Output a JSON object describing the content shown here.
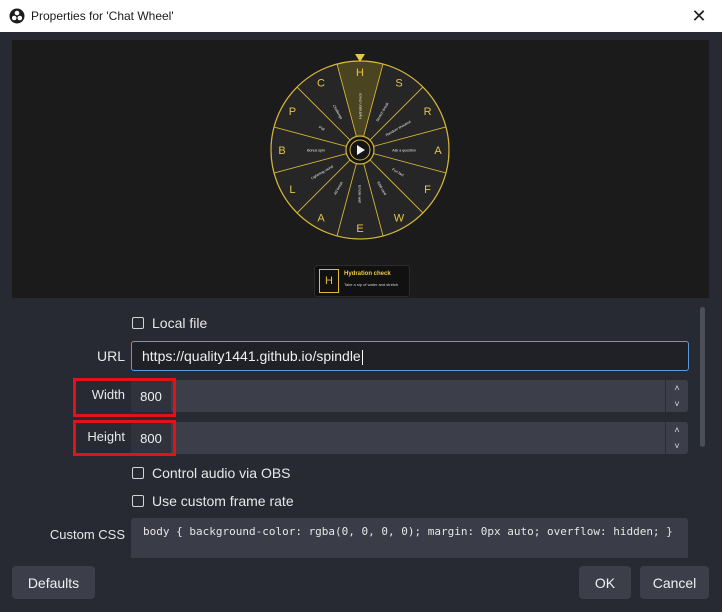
{
  "window": {
    "title": "Properties for 'Chat Wheel'",
    "close_glyph": "✕"
  },
  "preview": {
    "wheel": {
      "colors": {
        "segment_fill": "#262626",
        "segment_alt_fill": "#4a4420",
        "border": "#d4b63a",
        "letter": "#e6c448"
      },
      "segments": [
        {
          "key": "H",
          "label": "Hydration check"
        },
        {
          "key": "S",
          "label": "Stretch break"
        },
        {
          "key": "R",
          "label": "Random shoutout"
        },
        {
          "key": "A",
          "label": "Ask a question"
        },
        {
          "key": "F",
          "label": "Fun fact"
        },
        {
          "key": "W",
          "label": "Wild card"
        },
        {
          "key": "E",
          "label": "Emote wall"
        },
        {
          "key": "A",
          "label": "Ad break"
        },
        {
          "key": "L",
          "label": "Lightning round"
        },
        {
          "key": "B",
          "label": "Bonus spin"
        },
        {
          "key": "P",
          "label": "Poll"
        },
        {
          "key": "C",
          "label": "Challenge"
        }
      ]
    },
    "toast": {
      "key": "H",
      "title": "Hydration check",
      "subtitle": "Take a sip of water and stretch"
    }
  },
  "form": {
    "local_file": {
      "label": "Local file"
    },
    "url": {
      "label": "URL",
      "value": "https://quality1441.github.io/spindle"
    },
    "width": {
      "label": "Width",
      "value": "800"
    },
    "height": {
      "label": "Height",
      "value": "800"
    },
    "control_audio": {
      "label": "Control audio via OBS"
    },
    "custom_frame_rate": {
      "label": "Use custom frame rate"
    },
    "custom_css": {
      "label": "Custom CSS",
      "value": "body { background-color: rgba(0, 0, 0, 0); margin: 0px auto; overflow: hidden; }"
    }
  },
  "buttons": {
    "defaults": "Defaults",
    "ok": "OK",
    "cancel": "Cancel"
  },
  "icons": {
    "app": "obs-logo-icon",
    "spin_up": "˄",
    "spin_down": "˅",
    "play": "play-icon"
  },
  "highlight_color": "#e0131b"
}
